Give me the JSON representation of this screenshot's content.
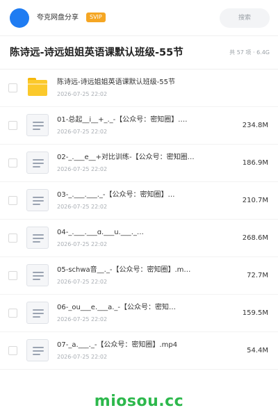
{
  "header": {
    "username": "夸克网盘分享",
    "badge": "SVIP",
    "search_placeholder": "搜索"
  },
  "folder": {
    "title": "陈诗远-诗远姐姐英语课默认班级-55节",
    "meta": "共 57 项 · 6.4G"
  },
  "items": [
    {
      "type": "folder",
      "name": "陈诗远-诗远姐姐英语课默认班级-55节",
      "date": "2026-07-25 22:02",
      "size": ""
    },
    {
      "type": "video",
      "name": "01-总起__i__+_._-【公众号：密知圈】.…",
      "date": "2026-07-25 22:02",
      "size": "234.8M"
    },
    {
      "type": "video",
      "name": "02-_.___e__+对比训练-【公众号：密知圈…",
      "date": "2026-07-25 22:02",
      "size": "186.9M"
    },
    {
      "type": "video",
      "name": "03-_.___.___._-【公众号：密知圈】…",
      "date": "2026-07-25 22:02",
      "size": "210.7M"
    },
    {
      "type": "video",
      "name": "04-_.___.___ɑ.___u.___._…",
      "date": "2026-07-25 22:02",
      "size": "268.6M"
    },
    {
      "type": "video",
      "name": "05-schwa音__._-【公众号：密知圈】.m…",
      "date": "2026-07-25 22:02",
      "size": "72.7M"
    },
    {
      "type": "video",
      "name": "06-_ou___e.___a._-【公众号：密知…",
      "date": "2026-07-25 22:02",
      "size": "159.5M"
    },
    {
      "type": "video",
      "name": "07-_a.___._-【公众号：密知圈】.mp4",
      "date": "2026-07-25 22:02",
      "size": "54.4M"
    }
  ],
  "watermark": "miosou.cc",
  "colors": {
    "avatar": "#1f7cf2",
    "badge": "#f5a623",
    "folder": "#fbc92b",
    "watermark": "#2db84c"
  }
}
